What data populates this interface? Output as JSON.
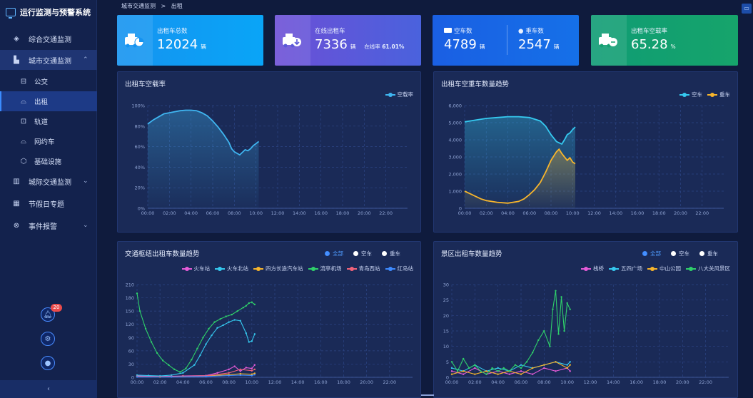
{
  "app": {
    "title": "运行监测与预警系统"
  },
  "breadcrumb": {
    "parent": "城市交通监测",
    "sep": ">",
    "current": "出租"
  },
  "nav": [
    {
      "id": "overview",
      "label": "综合交通监测",
      "icon": "layers-icon",
      "glyph": "◈"
    },
    {
      "id": "city",
      "label": "城市交通监测",
      "icon": "chart-icon",
      "glyph": "▙",
      "chevron": "⌃"
    },
    {
      "id": "bus",
      "label": "公交",
      "icon": "bus-icon",
      "glyph": "⊟"
    },
    {
      "id": "taxi",
      "label": "出租",
      "icon": "taxi-icon",
      "glyph": "⌓"
    },
    {
      "id": "rail",
      "label": "轨道",
      "icon": "train-icon",
      "glyph": "⊡"
    },
    {
      "id": "ridehail",
      "label": "网约车",
      "icon": "car-icon",
      "glyph": "⌓"
    },
    {
      "id": "infra",
      "label": "基础设施",
      "icon": "box-icon",
      "glyph": "⬡"
    },
    {
      "id": "intercity",
      "label": "城际交通监测",
      "icon": "building-icon",
      "glyph": "▥",
      "chevron": "⌄"
    },
    {
      "id": "holiday",
      "label": "节假日专题",
      "icon": "calendar-icon",
      "glyph": "▦"
    },
    {
      "id": "events",
      "label": "事件报警",
      "icon": "alarm-icon",
      "glyph": "⊗",
      "chevron": "⌄"
    }
  ],
  "notifications": {
    "count": "20"
  },
  "cards": {
    "total": {
      "label": "出租车总数",
      "value": "12024",
      "unit": "辆"
    },
    "online": {
      "label": "在线出租车",
      "value": "7336",
      "unit": "辆",
      "rate_label": "在线率",
      "rate": "61.01%"
    },
    "empty": {
      "label": "空车数",
      "value": "4789",
      "unit": "辆"
    },
    "loaded": {
      "label": "重车数",
      "value": "2547",
      "unit": "辆"
    },
    "empty_rate": {
      "label": "出租车空载率",
      "value": "65.28",
      "unit": "%"
    }
  },
  "filters": {
    "all": "全部",
    "empty": "空车",
    "loaded": "重车"
  },
  "colors": {
    "accent": "#3e8bff",
    "empty_line": "#35c9ef",
    "loaded_line": "#f7b52c",
    "card_total": "#1396f0",
    "card_online": "#5a58d8",
    "card_counts": "#1467e4",
    "card_rate": "#14a070"
  },
  "chart_data": [
    {
      "type": "line",
      "title": "出租车空载率",
      "series": [
        {
          "name": "空载率",
          "color": "#3fb5f0",
          "points": [
            [
              0,
              82
            ],
            [
              0.5,
              86
            ],
            [
              1,
              89
            ],
            [
              1.5,
              92
            ],
            [
              2,
              93
            ],
            [
              2.5,
              94
            ],
            [
              3,
              95
            ],
            [
              3.5,
              95.5
            ],
            [
              4,
              95.5
            ],
            [
              4.5,
              95
            ],
            [
              5,
              93
            ],
            [
              5.5,
              90
            ],
            [
              6,
              85
            ],
            [
              6.5,
              79
            ],
            [
              7,
              72
            ],
            [
              7.5,
              64
            ],
            [
              7.75,
              58
            ],
            [
              8,
              55
            ],
            [
              8.5,
              52
            ],
            [
              9,
              57
            ],
            [
              9.25,
              56
            ],
            [
              9.5,
              58
            ],
            [
              9.75,
              61
            ],
            [
              10,
              63
            ],
            [
              10.25,
              65
            ]
          ]
        }
      ],
      "x_ticks": [
        "00:00",
        "02:00",
        "04:00",
        "06:00",
        "08:00",
        "10:00",
        "12:00",
        "14:00",
        "16:00",
        "18:00",
        "20:00",
        "22:00"
      ],
      "y_ticks": [
        "0%",
        "20%",
        "40%",
        "60%",
        "80%",
        "100%"
      ],
      "ylim": [
        0,
        100
      ],
      "xlim": [
        0,
        24
      ]
    },
    {
      "type": "line",
      "title": "出租车空重车数量趋势",
      "series": [
        {
          "name": "空车",
          "color": "#35c9ef",
          "points": [
            [
              0,
              5050
            ],
            [
              1,
              5150
            ],
            [
              2,
              5250
            ],
            [
              3,
              5300
            ],
            [
              4,
              5350
            ],
            [
              5,
              5350
            ],
            [
              6,
              5300
            ],
            [
              7,
              5100
            ],
            [
              7.5,
              4800
            ],
            [
              8,
              4300
            ],
            [
              8.5,
              3900
            ],
            [
              9,
              3750
            ],
            [
              9.25,
              4000
            ],
            [
              9.5,
              4300
            ],
            [
              9.75,
              4400
            ],
            [
              10,
              4600
            ],
            [
              10.25,
              4750
            ]
          ]
        },
        {
          "name": "重车",
          "color": "#f7b52c",
          "points": [
            [
              0,
              1000
            ],
            [
              0.5,
              850
            ],
            [
              1,
              700
            ],
            [
              1.5,
              550
            ],
            [
              2,
              450
            ],
            [
              3,
              350
            ],
            [
              4,
              300
            ],
            [
              5,
              400
            ],
            [
              5.5,
              550
            ],
            [
              6,
              800
            ],
            [
              6.5,
              1100
            ],
            [
              7,
              1500
            ],
            [
              7.5,
              2100
            ],
            [
              8,
              2800
            ],
            [
              8.5,
              3300
            ],
            [
              8.75,
              3450
            ],
            [
              9,
              3200
            ],
            [
              9.5,
              2800
            ],
            [
              9.75,
              2950
            ],
            [
              10,
              2700
            ],
            [
              10.25,
              2600
            ]
          ]
        }
      ],
      "x_ticks": [
        "00:00",
        "02:00",
        "04:00",
        "06:00",
        "08:00",
        "10:00",
        "12:00",
        "14:00",
        "16:00",
        "18:00",
        "20:00",
        "22:00"
      ],
      "y_ticks": [
        "0",
        "1,000",
        "2,000",
        "3,000",
        "4,000",
        "5,000",
        "6,000"
      ],
      "ylim": [
        0,
        6000
      ],
      "xlim": [
        0,
        24
      ]
    },
    {
      "type": "line",
      "title": "交通枢纽出租车数量趋势",
      "series": [
        {
          "name": "火车站",
          "color": "#e65bd8",
          "points": [
            [
              0,
              3
            ],
            [
              2,
              2
            ],
            [
              4,
              3
            ],
            [
              6,
              4
            ],
            [
              7,
              10
            ],
            [
              8,
              18
            ],
            [
              8.5,
              25
            ],
            [
              9,
              14
            ],
            [
              9.5,
              22
            ],
            [
              10,
              20
            ],
            [
              10.25,
              28
            ]
          ]
        },
        {
          "name": "火车北站",
          "color": "#35c9ef",
          "points": [
            [
              0,
              5
            ],
            [
              1,
              4
            ],
            [
              2,
              3
            ],
            [
              3,
              5
            ],
            [
              4,
              10
            ],
            [
              5,
              28
            ],
            [
              5.5,
              50
            ],
            [
              6,
              75
            ],
            [
              6.5,
              95
            ],
            [
              7,
              112
            ],
            [
              7.5,
              118
            ],
            [
              8,
              125
            ],
            [
              8.5,
              130
            ],
            [
              9,
              128
            ],
            [
              9.5,
              100
            ],
            [
              9.75,
              80
            ],
            [
              10,
              82
            ],
            [
              10.25,
              98
            ]
          ]
        },
        {
          "name": "四方长途汽车站",
          "color": "#f7b52c",
          "points": [
            [
              0,
              2
            ],
            [
              2,
              1
            ],
            [
              4,
              2
            ],
            [
              6,
              3
            ],
            [
              8,
              6
            ],
            [
              9,
              8
            ],
            [
              10,
              7
            ],
            [
              10.25,
              9
            ]
          ]
        },
        {
          "name": "流亭机场",
          "color": "#2fd06a",
          "points": [
            [
              0,
              190
            ],
            [
              0.25,
              150
            ],
            [
              0.75,
              110
            ],
            [
              1.25,
              80
            ],
            [
              1.75,
              55
            ],
            [
              2.25,
              38
            ],
            [
              2.75,
              28
            ],
            [
              3.25,
              18
            ],
            [
              3.75,
              12
            ],
            [
              4.25,
              20
            ],
            [
              4.75,
              40
            ],
            [
              5.25,
              65
            ],
            [
              5.75,
              90
            ],
            [
              6.25,
              110
            ],
            [
              6.75,
              125
            ],
            [
              7.25,
              132
            ],
            [
              7.75,
              138
            ],
            [
              8.25,
              142
            ],
            [
              8.75,
              150
            ],
            [
              9.25,
              158
            ],
            [
              9.5,
              162
            ],
            [
              9.75,
              168
            ],
            [
              10,
              170
            ],
            [
              10.25,
              165
            ]
          ]
        },
        {
          "name": "青岛西站",
          "color": "#f2637a",
          "points": [
            [
              0,
              2
            ],
            [
              3,
              2
            ],
            [
              6,
              3
            ],
            [
              8,
              10
            ],
            [
              9,
              18
            ],
            [
              10,
              15
            ],
            [
              10.25,
              18
            ]
          ]
        },
        {
          "name": "红岛站",
          "color": "#3e8bff",
          "points": [
            [
              0,
              1
            ],
            [
              3,
              1
            ],
            [
              6,
              2
            ],
            [
              8,
              4
            ],
            [
              9,
              5
            ],
            [
              10,
              4
            ],
            [
              10.25,
              6
            ]
          ]
        }
      ],
      "x_ticks": [
        "00:00",
        "02:00",
        "04:00",
        "06:00",
        "08:00",
        "10:00",
        "12:00",
        "14:00",
        "16:00",
        "18:00",
        "20:00",
        "22:00"
      ],
      "y_ticks": [
        "0",
        "30",
        "60",
        "90",
        "120",
        "150",
        "180",
        "210"
      ],
      "ylim": [
        0,
        210
      ],
      "xlim": [
        0,
        24
      ]
    },
    {
      "type": "line",
      "title": "景区出租车数量趋势",
      "series": [
        {
          "name": "栈桥",
          "color": "#e65bd8",
          "points": [
            [
              0,
              2
            ],
            [
              1,
              1
            ],
            [
              2,
              3
            ],
            [
              3,
              1
            ],
            [
              4,
              2
            ],
            [
              5,
              1
            ],
            [
              6,
              2
            ],
            [
              7,
              1
            ],
            [
              8,
              3
            ],
            [
              9,
              2
            ],
            [
              10,
              3
            ],
            [
              10.25,
              2
            ]
          ]
        },
        {
          "name": "五四广场",
          "color": "#35c9ef",
          "points": [
            [
              0,
              3
            ],
            [
              1,
              2
            ],
            [
              2,
              4
            ],
            [
              3,
              2
            ],
            [
              4,
              3
            ],
            [
              5,
              2
            ],
            [
              6,
              4
            ],
            [
              7,
              3
            ],
            [
              8,
              4
            ],
            [
              9,
              5
            ],
            [
              10,
              4
            ],
            [
              10.25,
              5
            ]
          ]
        },
        {
          "name": "中山公园",
          "color": "#f7b52c",
          "points": [
            [
              0,
              1
            ],
            [
              1,
              2
            ],
            [
              2,
              1
            ],
            [
              3,
              2
            ],
            [
              4,
              1
            ],
            [
              5,
              2
            ],
            [
              6,
              1
            ],
            [
              7,
              3
            ],
            [
              8,
              4
            ],
            [
              9,
              5
            ],
            [
              10,
              3
            ],
            [
              10.25,
              4
            ]
          ]
        },
        {
          "name": "八大关风景区",
          "color": "#2fd06a",
          "points": [
            [
              0,
              5
            ],
            [
              0.5,
              2
            ],
            [
              1,
              6
            ],
            [
              1.5,
              3
            ],
            [
              2,
              4
            ],
            [
              2.5,
              2
            ],
            [
              3,
              1
            ],
            [
              3.5,
              3
            ],
            [
              4,
              2
            ],
            [
              4.5,
              3
            ],
            [
              5,
              2
            ],
            [
              5.5,
              4
            ],
            [
              6,
              3
            ],
            [
              6.5,
              5
            ],
            [
              7,
              8
            ],
            [
              7.5,
              12
            ],
            [
              8,
              15
            ],
            [
              8.5,
              10
            ],
            [
              8.75,
              22
            ],
            [
              9,
              28
            ],
            [
              9.25,
              14
            ],
            [
              9.5,
              26
            ],
            [
              9.75,
              15
            ],
            [
              10,
              24
            ],
            [
              10.25,
              22
            ]
          ]
        }
      ],
      "x_ticks": [
        "00:00",
        "02:00",
        "04:00",
        "06:00",
        "08:00",
        "10:00",
        "12:00",
        "14:00",
        "16:00",
        "18:00",
        "20:00",
        "22:00"
      ],
      "y_ticks": [
        "0",
        "5",
        "10",
        "15",
        "20",
        "25",
        "30"
      ],
      "ylim": [
        0,
        30
      ],
      "xlim": [
        0,
        24
      ]
    }
  ]
}
